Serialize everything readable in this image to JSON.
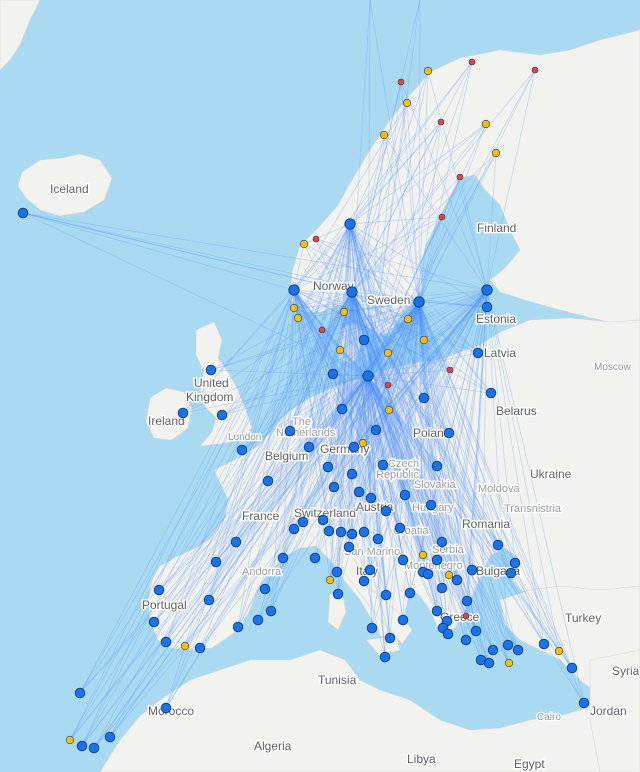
{
  "map": {
    "colors": {
      "water": "#aadaf1",
      "land": "#f2f2ee",
      "hub_marker": "#1a73e8",
      "seasonal_marker": "#fbbc04",
      "small_marker": "#ea4335",
      "route": "#4d90fe"
    },
    "country_labels": {
      "iceland": "Iceland",
      "finland": "Finland",
      "norway": "Norway",
      "sweden": "Sweden",
      "estonia": "Estonia",
      "latvia": "Latvia",
      "united_kingdom_1": "United",
      "united_kingdom_2": "Kingdom",
      "ireland": "Ireland",
      "belarus": "Belarus",
      "the_netherlands_1": "The",
      "the_netherlands_2": "Netherlands",
      "belgium": "Belgium",
      "germany": "Germany",
      "poland": "Poland",
      "czech_republic_1": "Czech",
      "czech_republic_2": "Republic",
      "slovakia": "Slovakia",
      "ukraine": "Ukraine",
      "moldova": "Moldova",
      "transnistria": "Transnistria",
      "france": "France",
      "switzerland": "Switzerland",
      "austria": "Austria",
      "hungary": "Hungary",
      "croatia": "Croatia",
      "romania": "Romania",
      "andorra": "Andorra",
      "san_marino": "San Marino",
      "serbia": "Serbia",
      "montenegro": "Montenegro",
      "bulgaria": "Bulgaria",
      "italy": "Italy",
      "portugal": "Portugal",
      "greece": "Greece",
      "turkey": "Turkey",
      "syria": "Syria",
      "tunisia": "Tunisia",
      "morocco": "Morocco",
      "algeria": "Algeria",
      "libya": "Libya",
      "egypt": "Egypt",
      "jordan": "Jordan"
    },
    "city_labels": {
      "moscow": "Moscow",
      "london": "London",
      "cairo": "Cairo"
    }
  }
}
